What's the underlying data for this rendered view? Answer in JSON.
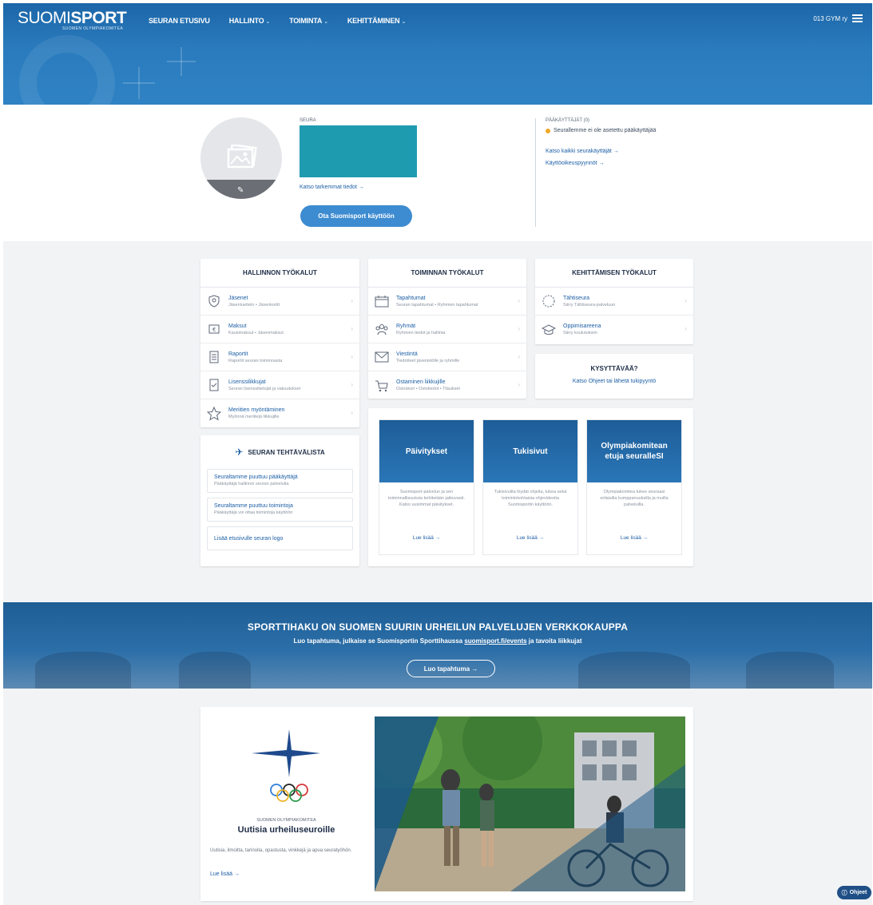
{
  "header": {
    "logo_light": "SUOMI",
    "logo_bold": "SPORT",
    "logo_sub": "SUOMEN OLYMPIAKOMITEA",
    "nav": [
      {
        "label": "SEURAN ETUSIVU",
        "chevron": ""
      },
      {
        "label": "HALLINTO",
        "chevron": "⌄"
      },
      {
        "label": "TOIMINTA",
        "chevron": "⌄"
      },
      {
        "label": "KEHITTÄMINEN",
        "chevron": "⌄"
      }
    ],
    "user": "013 GYM ry"
  },
  "club": {
    "seura_label": "SEURA",
    "details_link": "Katso tarkemmat tiedot →",
    "take_button": "Ota Suomisport käyttöön",
    "admins_title": "PÄÄKÄYTTÄJÄT (0)",
    "admins_warning": "Seurallemme ei ole asetettu pääkäyttäjää",
    "all_users_link": "Katso kaikki seurakäyttäjät →",
    "rights_link": "Käyttöoikeuspyynnöt →"
  },
  "tools": {
    "hallinto": {
      "title": "HALLINNON TYÖKALUT",
      "items": [
        {
          "label": "Jäsenet",
          "sub": "Jäsenluettelo • Jäsenkortit",
          "icon": "member-shield-icon"
        },
        {
          "label": "Maksut",
          "sub": "Kausimaksut • Jäsenmaksut",
          "icon": "payment-icon"
        },
        {
          "label": "Raportit",
          "sub": "Raportit seuran toiminnasta",
          "icon": "report-icon"
        },
        {
          "label": "Lisenssilikkujat",
          "sub": "Seuran lisenssitietojät ja vakuutukset",
          "icon": "license-icon"
        },
        {
          "label": "Meriitien myöntäminen",
          "sub": "Myönnä meriitejä liikkujille",
          "icon": "star-icon"
        }
      ]
    },
    "toiminta": {
      "title": "TOIMINNAN TYÖKALUT",
      "items": [
        {
          "label": "Tapahtumat",
          "sub": "Seuran tapahtumat • Ryhmien tapahtumat",
          "icon": "calendar-icon"
        },
        {
          "label": "Ryhmät",
          "sub": "Ryhmien tiedot ja hallinta",
          "icon": "group-icon"
        },
        {
          "label": "Viestintä",
          "sub": "Tiedotteet jäsenistölle ja ryhmille",
          "icon": "mail-icon"
        },
        {
          "label": "Ostaminen liikkujille",
          "sub": "Ostoskori • Ostotiedot • Tilaukset",
          "icon": "cart-icon"
        }
      ]
    },
    "kehittaminen": {
      "title": "KEHITTÄMISEN TYÖKALUT",
      "items": [
        {
          "label": "Tähtiseura",
          "sub": "Siirry Tähtiseura-palveluun",
          "icon": "star-badge-icon"
        },
        {
          "label": "Oppimisareena",
          "sub": "Siirry koulutuksiin",
          "icon": "graduation-cap-icon"
        }
      ]
    },
    "questions": {
      "title": "KYSYTTÄVÄÄ?",
      "text": "Katso Ohjeet tai lähetä tukipyyntö"
    }
  },
  "tasks": {
    "title": "SEURAN TEHTÄVÄLISTA",
    "items": [
      {
        "label": "Seuraltamme puuttuu pääkäyttäjä",
        "sub": "Pääkäyttäjä hallinnoi seuran palveluita"
      },
      {
        "label": "Seuraltamme puuttuu toimintoja",
        "sub": "Pääkäyttäjä voi ottaa toimintoja käyttöön"
      },
      {
        "label": "Lisää etusivulle seuran logo",
        "sub": ""
      }
    ]
  },
  "promos": [
    {
      "title": "Päivitykset",
      "desc": "Suomisport-palvelun ja sen toiminnallisuuksia kehitetään jatkuvasti. Katso uusimmat päivitykset.",
      "more": "Lue lisää →"
    },
    {
      "title": "Tukisivut",
      "desc": "Tukisivuilta löydät ohjeita, tukea sekä toimintokohtaisia ohjevideoita Suomisportin käyttöön.",
      "more": "Lue lisää →"
    },
    {
      "title": "Olympiakomitean etuja seuralleSI",
      "desc": "Olympiakomitea tukee seuraasi erilaisilla kumppanuuksilla ja muilla palveluilla.",
      "more": "Lue lisää →"
    }
  ],
  "banner": {
    "title": "SPORTTIHAKU ON SUOMEN SUURIN URHEILUN PALVELUJEN VERKKOKAUPPA",
    "text_before": "Luo tapahtuma, julkaise se Suomisportin Sporttihaussa ",
    "link": "suomisport.fi/events",
    "text_after": " ja tavoita liikkujat",
    "button": "Luo tapahtuma →"
  },
  "news": {
    "org": "SUOMEN OLYMPIAKOMITEA",
    "title": "Uutisia urheiluseuroille",
    "desc": "Uutisia, ilmoitta, tarinoita, opastusta, vinkkejä ja apua seuratyöhön.",
    "more": "Lue lisää →"
  },
  "help": {
    "label": "Ohjeet"
  }
}
